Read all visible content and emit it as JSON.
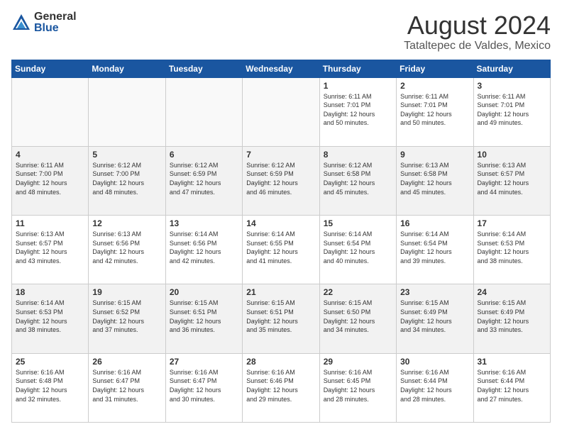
{
  "logo": {
    "general": "General",
    "blue": "Blue"
  },
  "title": "August 2024",
  "subtitle": "Tataltepec de Valdes, Mexico",
  "weekdays": [
    "Sunday",
    "Monday",
    "Tuesday",
    "Wednesday",
    "Thursday",
    "Friday",
    "Saturday"
  ],
  "weeks": [
    [
      {
        "day": "",
        "info": ""
      },
      {
        "day": "",
        "info": ""
      },
      {
        "day": "",
        "info": ""
      },
      {
        "day": "",
        "info": ""
      },
      {
        "day": "1",
        "info": "Sunrise: 6:11 AM\nSunset: 7:01 PM\nDaylight: 12 hours\nand 50 minutes."
      },
      {
        "day": "2",
        "info": "Sunrise: 6:11 AM\nSunset: 7:01 PM\nDaylight: 12 hours\nand 50 minutes."
      },
      {
        "day": "3",
        "info": "Sunrise: 6:11 AM\nSunset: 7:01 PM\nDaylight: 12 hours\nand 49 minutes."
      }
    ],
    [
      {
        "day": "4",
        "info": "Sunrise: 6:11 AM\nSunset: 7:00 PM\nDaylight: 12 hours\nand 48 minutes."
      },
      {
        "day": "5",
        "info": "Sunrise: 6:12 AM\nSunset: 7:00 PM\nDaylight: 12 hours\nand 48 minutes."
      },
      {
        "day": "6",
        "info": "Sunrise: 6:12 AM\nSunset: 6:59 PM\nDaylight: 12 hours\nand 47 minutes."
      },
      {
        "day": "7",
        "info": "Sunrise: 6:12 AM\nSunset: 6:59 PM\nDaylight: 12 hours\nand 46 minutes."
      },
      {
        "day": "8",
        "info": "Sunrise: 6:12 AM\nSunset: 6:58 PM\nDaylight: 12 hours\nand 45 minutes."
      },
      {
        "day": "9",
        "info": "Sunrise: 6:13 AM\nSunset: 6:58 PM\nDaylight: 12 hours\nand 45 minutes."
      },
      {
        "day": "10",
        "info": "Sunrise: 6:13 AM\nSunset: 6:57 PM\nDaylight: 12 hours\nand 44 minutes."
      }
    ],
    [
      {
        "day": "11",
        "info": "Sunrise: 6:13 AM\nSunset: 6:57 PM\nDaylight: 12 hours\nand 43 minutes."
      },
      {
        "day": "12",
        "info": "Sunrise: 6:13 AM\nSunset: 6:56 PM\nDaylight: 12 hours\nand 42 minutes."
      },
      {
        "day": "13",
        "info": "Sunrise: 6:14 AM\nSunset: 6:56 PM\nDaylight: 12 hours\nand 42 minutes."
      },
      {
        "day": "14",
        "info": "Sunrise: 6:14 AM\nSunset: 6:55 PM\nDaylight: 12 hours\nand 41 minutes."
      },
      {
        "day": "15",
        "info": "Sunrise: 6:14 AM\nSunset: 6:54 PM\nDaylight: 12 hours\nand 40 minutes."
      },
      {
        "day": "16",
        "info": "Sunrise: 6:14 AM\nSunset: 6:54 PM\nDaylight: 12 hours\nand 39 minutes."
      },
      {
        "day": "17",
        "info": "Sunrise: 6:14 AM\nSunset: 6:53 PM\nDaylight: 12 hours\nand 38 minutes."
      }
    ],
    [
      {
        "day": "18",
        "info": "Sunrise: 6:14 AM\nSunset: 6:53 PM\nDaylight: 12 hours\nand 38 minutes."
      },
      {
        "day": "19",
        "info": "Sunrise: 6:15 AM\nSunset: 6:52 PM\nDaylight: 12 hours\nand 37 minutes."
      },
      {
        "day": "20",
        "info": "Sunrise: 6:15 AM\nSunset: 6:51 PM\nDaylight: 12 hours\nand 36 minutes."
      },
      {
        "day": "21",
        "info": "Sunrise: 6:15 AM\nSunset: 6:51 PM\nDaylight: 12 hours\nand 35 minutes."
      },
      {
        "day": "22",
        "info": "Sunrise: 6:15 AM\nSunset: 6:50 PM\nDaylight: 12 hours\nand 34 minutes."
      },
      {
        "day": "23",
        "info": "Sunrise: 6:15 AM\nSunset: 6:49 PM\nDaylight: 12 hours\nand 34 minutes."
      },
      {
        "day": "24",
        "info": "Sunrise: 6:15 AM\nSunset: 6:49 PM\nDaylight: 12 hours\nand 33 minutes."
      }
    ],
    [
      {
        "day": "25",
        "info": "Sunrise: 6:16 AM\nSunset: 6:48 PM\nDaylight: 12 hours\nand 32 minutes."
      },
      {
        "day": "26",
        "info": "Sunrise: 6:16 AM\nSunset: 6:47 PM\nDaylight: 12 hours\nand 31 minutes."
      },
      {
        "day": "27",
        "info": "Sunrise: 6:16 AM\nSunset: 6:47 PM\nDaylight: 12 hours\nand 30 minutes."
      },
      {
        "day": "28",
        "info": "Sunrise: 6:16 AM\nSunset: 6:46 PM\nDaylight: 12 hours\nand 29 minutes."
      },
      {
        "day": "29",
        "info": "Sunrise: 6:16 AM\nSunset: 6:45 PM\nDaylight: 12 hours\nand 28 minutes."
      },
      {
        "day": "30",
        "info": "Sunrise: 6:16 AM\nSunset: 6:44 PM\nDaylight: 12 hours\nand 28 minutes."
      },
      {
        "day": "31",
        "info": "Sunrise: 6:16 AM\nSunset: 6:44 PM\nDaylight: 12 hours\nand 27 minutes."
      }
    ]
  ]
}
